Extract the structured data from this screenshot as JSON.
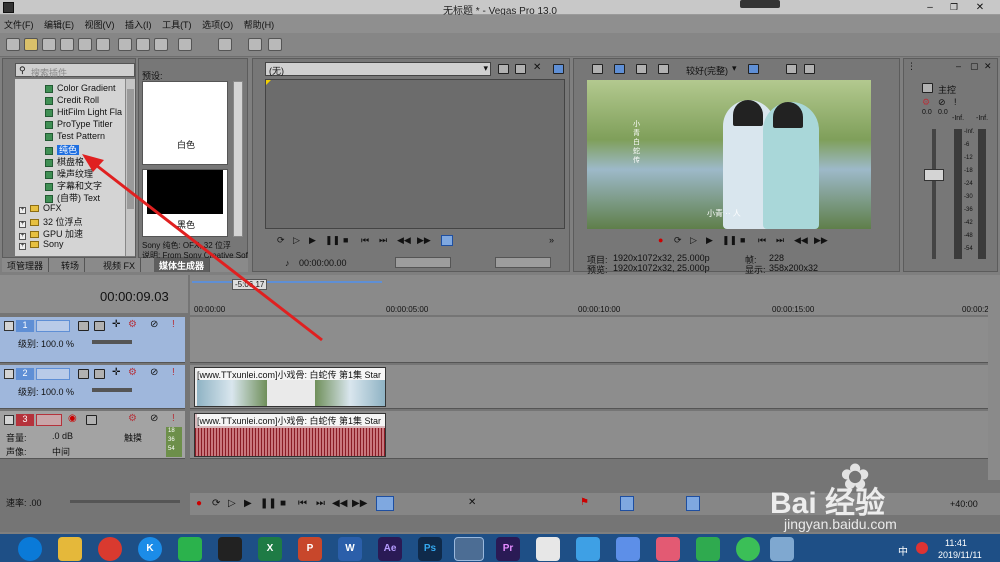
{
  "window": {
    "title": "无标题 * - Vegas Pro 13.0"
  },
  "menu": [
    "文件(F)",
    "编辑(E)",
    "视图(V)",
    "插入(I)",
    "工具(T)",
    "选项(O)",
    "帮助(H)"
  ],
  "plugin_panel": {
    "search_placeholder": "搜索插件",
    "items": [
      {
        "label": "Color Gradient"
      },
      {
        "label": "Credit Roll"
      },
      {
        "label": "HitFilm Light Fla"
      },
      {
        "label": "ProType Titler"
      },
      {
        "label": "Test Pattern"
      },
      {
        "label": "纯色"
      },
      {
        "label": "棋盘格"
      },
      {
        "label": "噪声纹理"
      },
      {
        "label": "字幕和文字"
      },
      {
        "label": "(自带) Text"
      }
    ],
    "folders": [
      "OFX",
      "32 位浮点",
      "GPU 加速",
      "Sony"
    ],
    "preset_label": "预设:",
    "preset_white": "白色",
    "preset_black": "黑色",
    "desc_line1": "Sony 纯色: OFX, 32 位浮",
    "desc_line2": "说明: From Sony Creative Softw",
    "tabs": [
      "项管理器",
      "转场",
      "视频 FX",
      "媒体生成器"
    ]
  },
  "trimmer": {
    "dropdown_value": "(无)",
    "timecode": "00:00:00.00"
  },
  "preview": {
    "quality": "较好(完整)",
    "subtitle": "小青 ·· 人",
    "vertical_text": "小青 白蛇传",
    "project_label": "项目:",
    "project_value": "1920x1072x32, 25.000p",
    "preview_label": "预览:",
    "preview_value": "1920x1072x32, 25.000p",
    "frame_label": "帧:",
    "frame_value": "228",
    "display_label": "显示:",
    "display_value": "358x200x32"
  },
  "mixer": {
    "title": "主控",
    "scale": [
      "-Inf.",
      "-6",
      "-12",
      "-18",
      "-24",
      "-30",
      "-36",
      "-42",
      "-48",
      "-54"
    ],
    "value_left": "-Inf.",
    "value_right": "-Inf.",
    "db_left": "0.0",
    "db_right": "0.0"
  },
  "timeline": {
    "timecode": "00:00:09.03",
    "marker": "-5:06.17",
    "ruler": [
      "00:00:00",
      "00:00:05:00",
      "00:00:10:00",
      "00:00:15:00",
      "00:00:20:"
    ],
    "end_time": "+40:00",
    "rate_label": "速率: .00",
    "tracks": [
      {
        "num": "1",
        "level_label": "级别: 100.0 %"
      },
      {
        "num": "2",
        "level_label": "级别: 100.0 %"
      },
      {
        "num": "3",
        "vol_label": "音量:",
        "vol_value": ".0 dB",
        "pan_label": "声像:",
        "pan_value": "中间",
        "mode": "触摸",
        "meters": [
          "18",
          "36",
          "54"
        ]
      }
    ],
    "clip_title": "[www.TTxunlei.com]小戏骨: 白蛇传 第1集 Star"
  },
  "taskbar": {
    "time": "11:41",
    "date": "2019/11/11",
    "ime": "中",
    "apps": [
      "Ae",
      "Ps",
      "Pr",
      "W",
      "X",
      "P",
      "K"
    ]
  },
  "watermark": {
    "brand": "Bai 经验",
    "url": "jingyan.baidu.com"
  },
  "colors": {
    "selected": "#1f6fe0",
    "arrow": "#e02020",
    "track_red": "#b5323b",
    "track_blue": "#5f8fd5"
  }
}
